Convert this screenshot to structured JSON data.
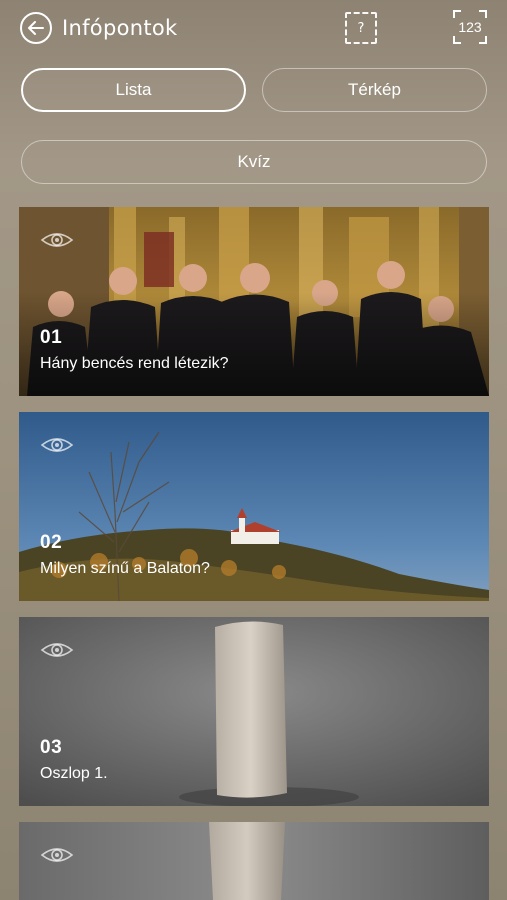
{
  "header": {
    "title": "Infópontok",
    "back_icon": "arrow-left-circle-icon",
    "help_label": "?",
    "number_label": "123"
  },
  "tabs": [
    {
      "label": "Lista",
      "active": true
    },
    {
      "label": "Térkép",
      "active": false
    }
  ],
  "quiz": {
    "label": "Kvíz"
  },
  "cards": [
    {
      "number": "01",
      "title": "Hány bencés rend létezik?"
    },
    {
      "number": "02",
      "title": "Milyen színű a Balaton?"
    },
    {
      "number": "03",
      "title": "Oszlop 1."
    },
    {
      "number": "",
      "title": ""
    }
  ],
  "colors": {
    "background": "#9c927f",
    "text": "#ffffff"
  }
}
